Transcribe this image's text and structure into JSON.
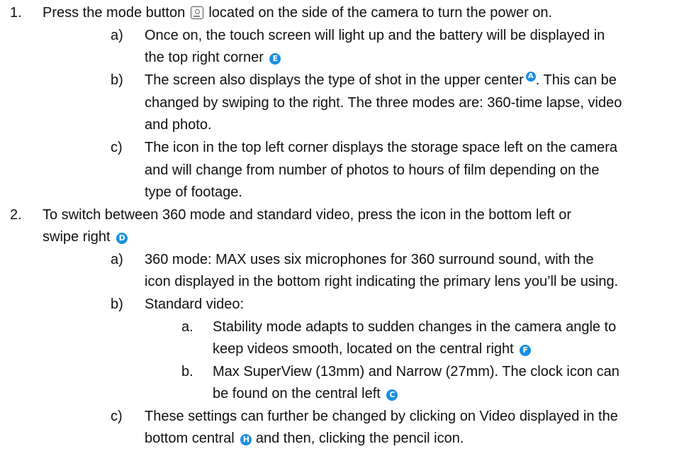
{
  "items": {
    "i1": {
      "num": "1.",
      "text_a": "Press the mode button",
      "text_b": "located on the side of the camera to turn the power on.",
      "subs": {
        "a": {
          "marker": "a)",
          "l1": "Once on, the touch screen will light up and the battery will be displayed in",
          "l2": "the top right corner",
          "badge": "E"
        },
        "b": {
          "marker": "b)",
          "l1a": "The screen also displays the type of shot in the upper center",
          "badge": "A",
          "l1b": ". This can be",
          "l2": "changed by swiping to the right. The three modes are: 360-time lapse, video",
          "l3": "and photo."
        },
        "c": {
          "marker": "c)",
          "l1": "The icon in the top left corner displays the storage space left on the camera",
          "l2": "and will change from number of photos to hours of film depending on the",
          "l3": "type of footage."
        }
      }
    },
    "i2": {
      "num": "2.",
      "l1": "To switch between 360 mode and standard video, press the icon in the bottom left or",
      "l2": "swipe right",
      "badge": "D",
      "subs": {
        "a": {
          "marker": "a)",
          "l1": "360 mode: MAX uses six microphones for 360 surround sound, with the",
          "l2": "icon displayed in the bottom right indicating the primary lens you’ll be using."
        },
        "b": {
          "marker": "b)",
          "l1": "Standard video:",
          "subs": {
            "a": {
              "marker": "a.",
              "l1": "Stability mode adapts to sudden changes in the camera angle to",
              "l2": "keep videos smooth, located on the central right",
              "badge": "F"
            },
            "b": {
              "marker": "b.",
              "l1": "Max SuperView (13mm) and Narrow (27mm). The clock icon can",
              "l2": "be found on the central left",
              "badge": "C"
            }
          }
        },
        "c": {
          "marker": "c)",
          "l1": "These settings can further be changed by clicking on Video displayed in the",
          "l2a": "bottom central",
          "badge": "H",
          "l2b": "and then, clicking the pencil icon."
        }
      }
    }
  },
  "colors": {
    "badge": "#1a8fe3",
    "text": "#111111"
  }
}
